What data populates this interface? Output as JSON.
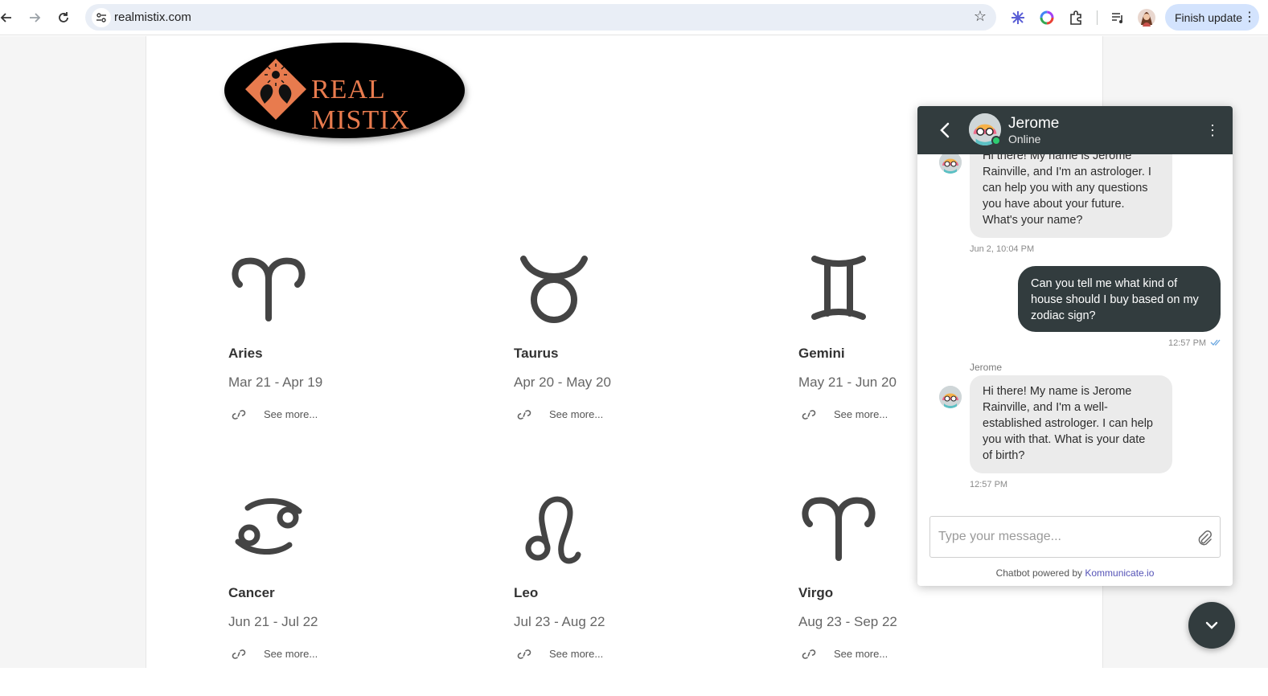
{
  "browser": {
    "url": "realmistix.com",
    "finish_update_label": "Finish update"
  },
  "logo": {
    "text": "REAL MISTIX"
  },
  "zodiac": [
    {
      "name": "Aries",
      "dates": "Mar 21 - Apr 19",
      "see_more": "See more..."
    },
    {
      "name": "Taurus",
      "dates": "Apr 20 - May 20",
      "see_more": "See more..."
    },
    {
      "name": "Gemini",
      "dates": "May 21 - Jun 20",
      "see_more": "See more..."
    },
    {
      "name": "Cancer",
      "dates": "Jun 21 - Jul 22",
      "see_more": "See more..."
    },
    {
      "name": "Leo",
      "dates": "Jul 23 - Aug 22",
      "see_more": "See more..."
    },
    {
      "name": "Virgo",
      "dates": "Aug 23 - Sep 22",
      "see_more": "See more..."
    }
  ],
  "chat": {
    "agent_name": "Jerome",
    "status": "Online",
    "messages": [
      {
        "text_lines": [
          "Hi there! My name is Jerome",
          "Rainville, and I'm an astrologer. I",
          "can help you with any questions",
          "you have about your future.",
          "What's your name?"
        ],
        "time": "Jun 2, 10:04 PM"
      },
      {
        "text_lines": [
          "Can you tell me what kind of",
          "house should I buy based on my",
          "zodiac sign?"
        ],
        "time": "12:57 PM"
      },
      {
        "sender": "Jerome",
        "text_lines": [
          "Hi there! My name is Jerome",
          "Rainville, and I'm a well-",
          "established astrologer. I can help",
          "you with that. What is your date",
          "of birth?"
        ],
        "time": "12:57 PM"
      }
    ],
    "input_placeholder": "Type your message...",
    "powered_prefix": "Chatbot powered by",
    "powered_link": "Kommunicate.io"
  },
  "colors": {
    "chat_header": "#323c3e",
    "logo_accent": "#e87b4e",
    "online": "#2ecc71",
    "link": "#5553b7"
  }
}
